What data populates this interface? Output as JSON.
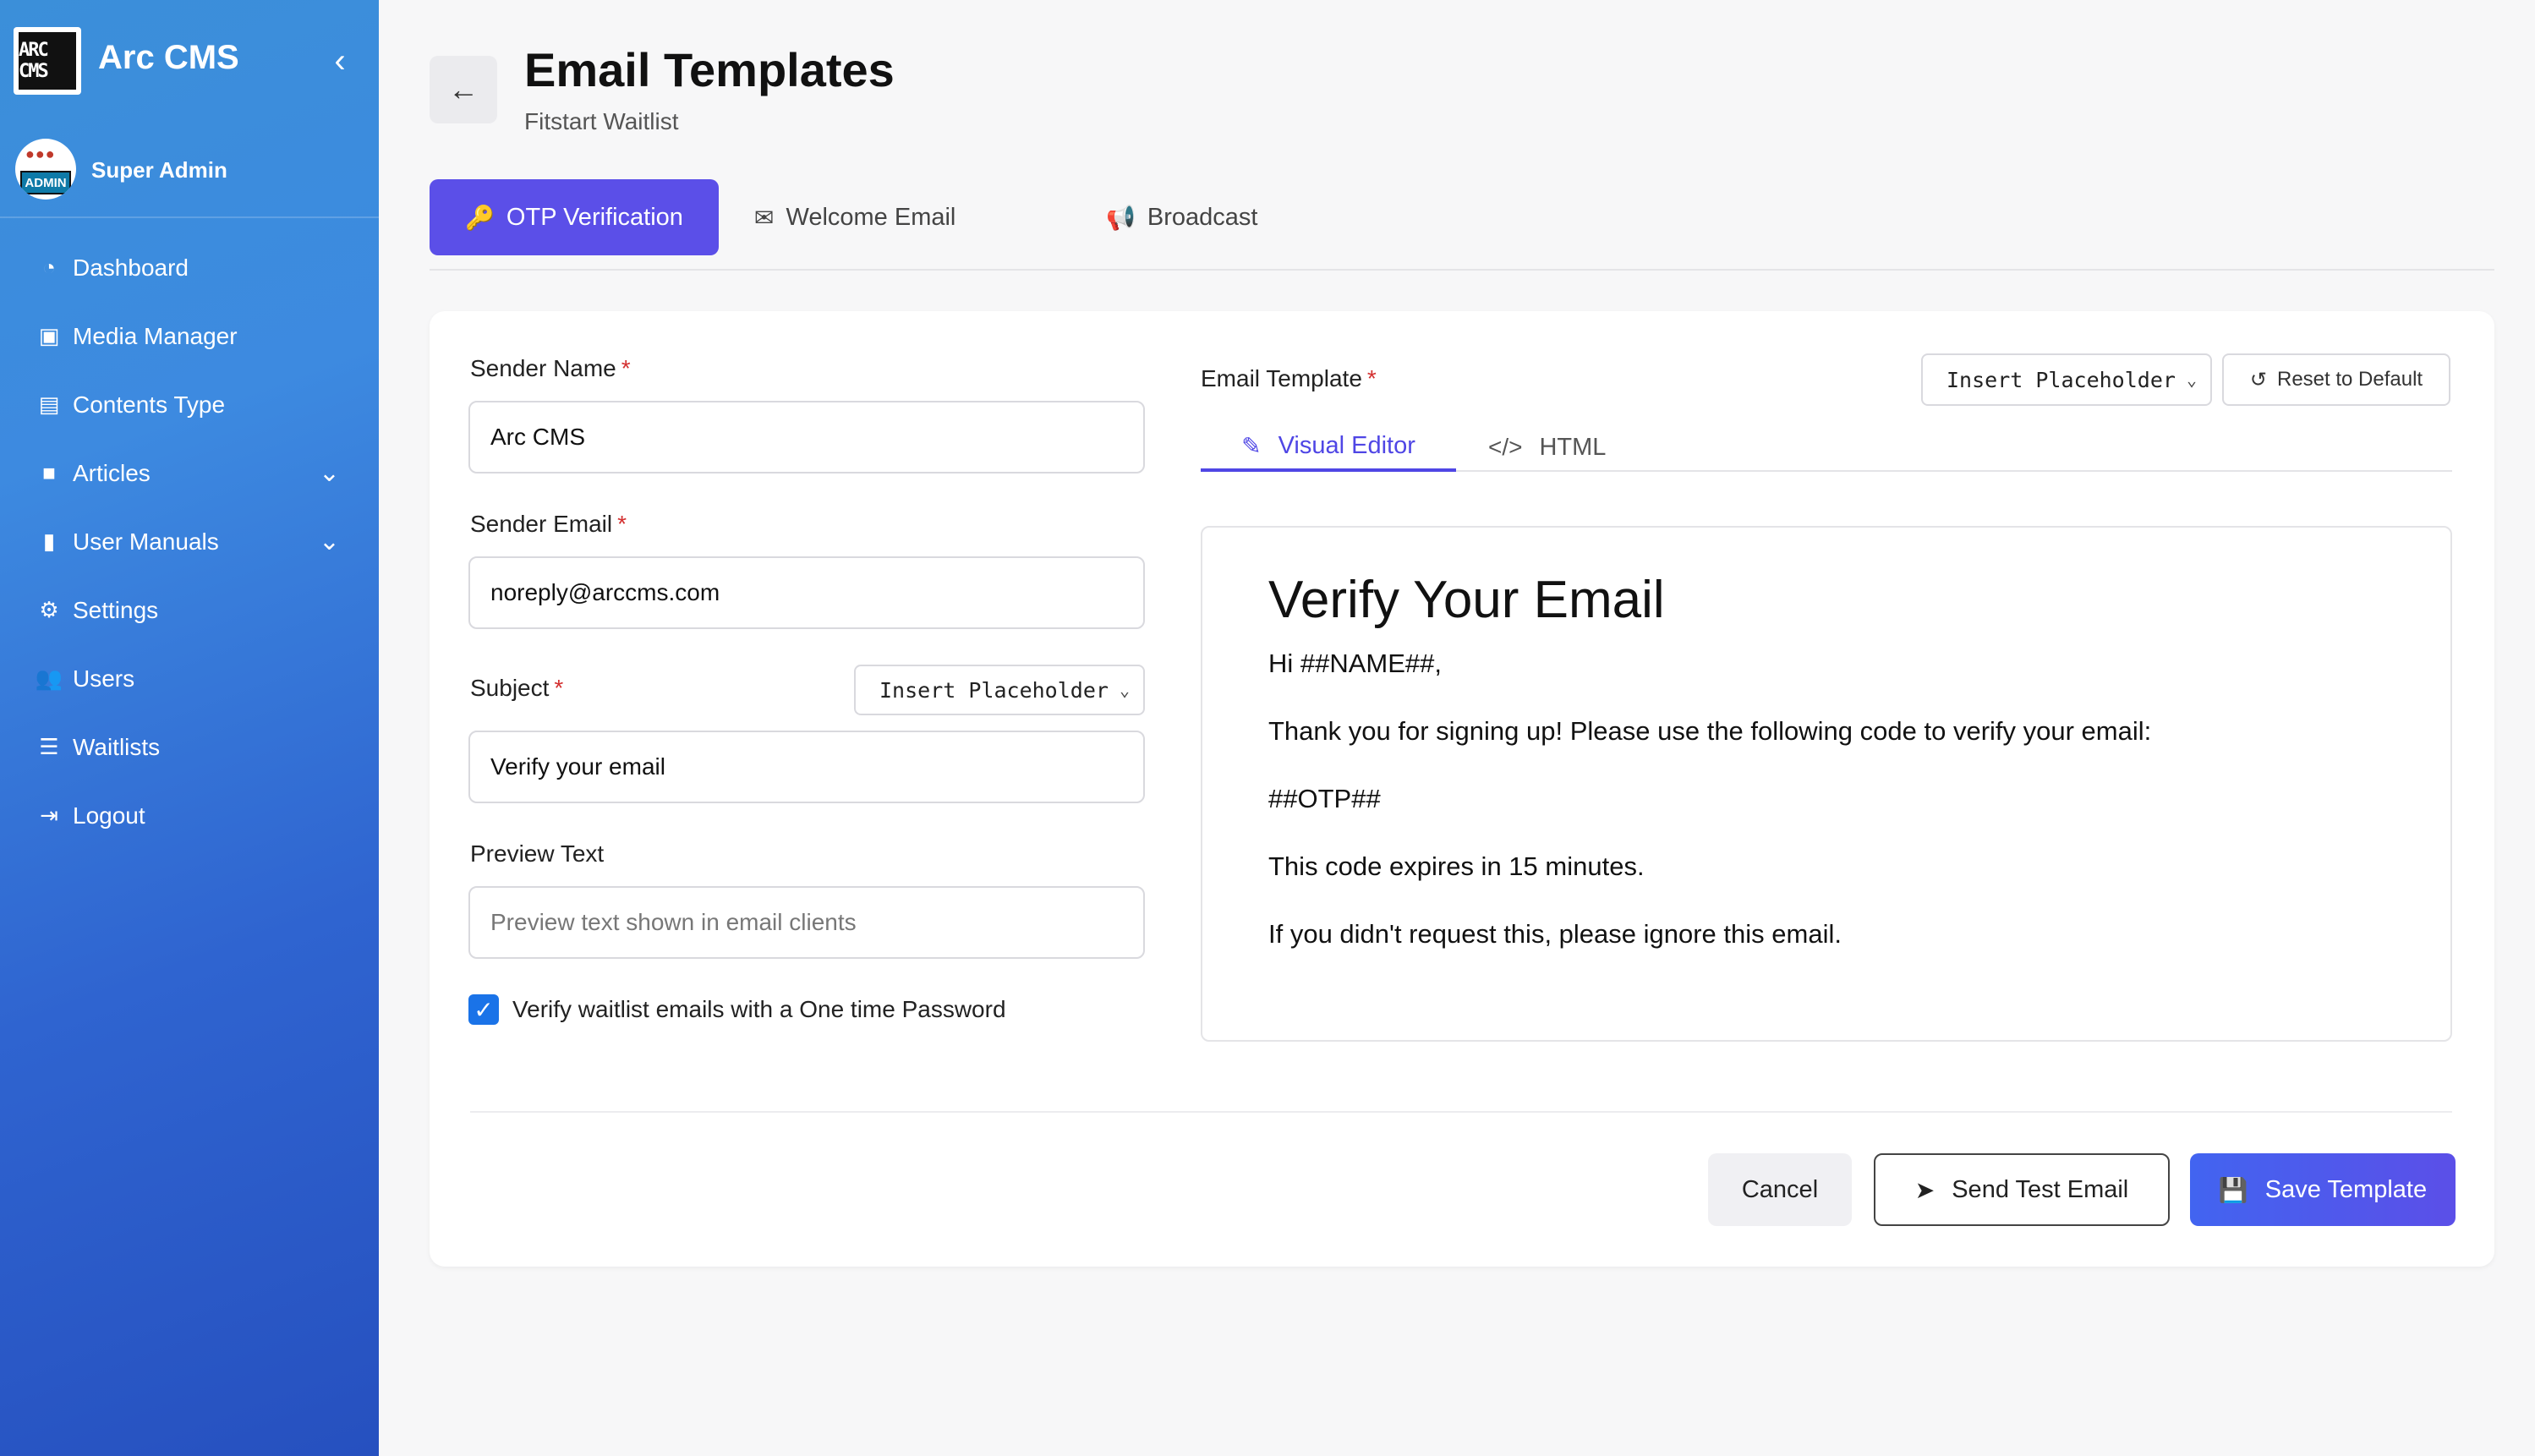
{
  "sidebar": {
    "logo_text": "ARC CMS",
    "brand": "Arc CMS",
    "user": {
      "name": "Super Admin",
      "avatar_tag": "ADMIN"
    },
    "items": [
      {
        "label": "Dashboard",
        "icon": "dashboard-icon"
      },
      {
        "label": "Media Manager",
        "icon": "image-icon"
      },
      {
        "label": "Contents Type",
        "icon": "book-icon"
      },
      {
        "label": "Articles",
        "icon": "video-icon",
        "expandable": true
      },
      {
        "label": "User Manuals",
        "icon": "manual-icon",
        "expandable": true
      },
      {
        "label": "Settings",
        "icon": "gear-icon"
      },
      {
        "label": "Users",
        "icon": "users-icon"
      },
      {
        "label": "Waitlists",
        "icon": "list-icon"
      },
      {
        "label": "Logout",
        "icon": "logout-icon"
      }
    ]
  },
  "header": {
    "title": "Email Templates",
    "subtitle": "Fitstart Waitlist"
  },
  "tabs": [
    {
      "label": "OTP Verification",
      "active": true
    },
    {
      "label": "Welcome Email",
      "active": false
    },
    {
      "label": "Broadcast",
      "active": false
    }
  ],
  "form": {
    "sender_name": {
      "label": "Sender Name",
      "value": "Arc CMS"
    },
    "sender_email": {
      "label": "Sender Email",
      "value": "noreply@arccms.com"
    },
    "subject": {
      "label": "Subject",
      "value": "Verify your email",
      "placeholder_select": "Insert Placeholder"
    },
    "preview_text": {
      "label": "Preview Text",
      "placeholder": "Preview text shown in email clients"
    },
    "verify_otp": {
      "label": "Verify waitlist emails with a One time Password",
      "checked": true
    }
  },
  "template": {
    "label": "Email Template",
    "placeholder_select": "Insert Placeholder",
    "reset_label": "Reset to Default",
    "editor_tabs": [
      {
        "label": "Visual Editor",
        "active": true
      },
      {
        "label": "HTML",
        "active": false
      }
    ],
    "preview": {
      "heading": "Verify Your Email",
      "greeting": "Hi ##NAME##,",
      "line1": "Thank you for signing up! Please use the following code to verify your email:",
      "otp": "##OTP##",
      "line2": "This code expires in 15 minutes.",
      "line3": "If you didn't request this, please ignore this email."
    }
  },
  "actions": {
    "cancel": "Cancel",
    "send_test": "Send Test Email",
    "save": "Save Template"
  },
  "colors": {
    "primary": "#5b4fe8",
    "accent_blue": "#1a73e8",
    "required": "#d32f2f"
  }
}
